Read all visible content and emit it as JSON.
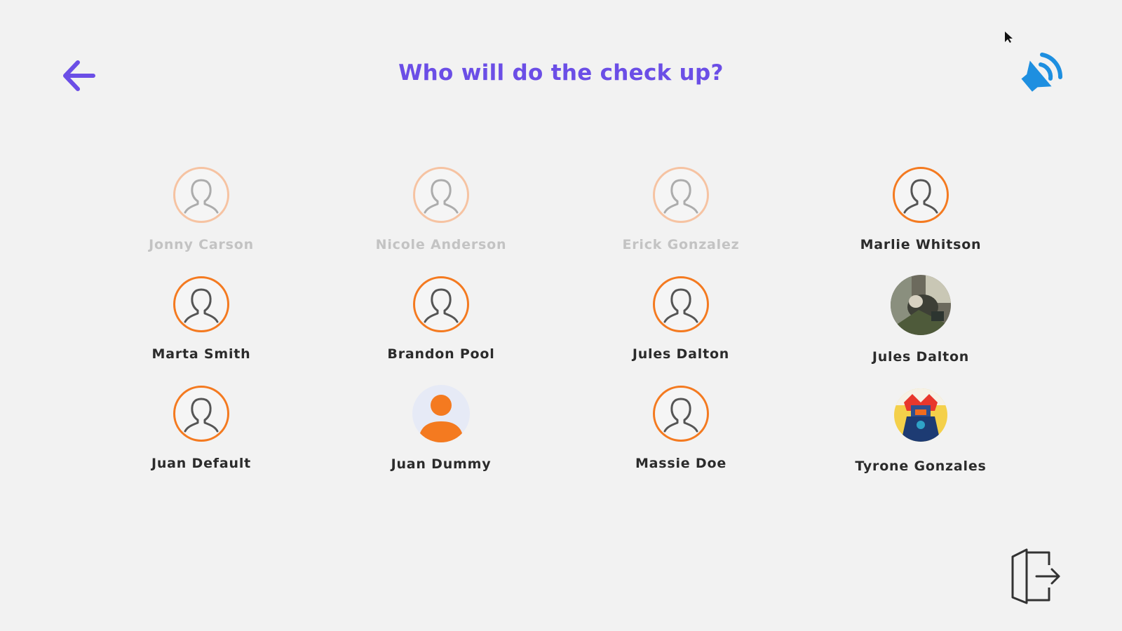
{
  "header": {
    "title": "Who will do the check up?",
    "back_icon": "arrow-left-icon",
    "speaker_icon": "speaker-icon"
  },
  "colors": {
    "accent": "#6b4ee6",
    "ring": "#f47a20",
    "ring_disabled": "#f6c3a2",
    "speaker": "#1e8fe0"
  },
  "users": [
    {
      "name": "Jonny  Carson",
      "avatar": "default",
      "disabled": true
    },
    {
      "name": "Nicole Anderson",
      "avatar": "default",
      "disabled": true
    },
    {
      "name": "Erick Gonzalez",
      "avatar": "default",
      "disabled": true
    },
    {
      "name": "Marlie Whitson",
      "avatar": "default",
      "disabled": false
    },
    {
      "name": "Marta Smith",
      "avatar": "default",
      "disabled": false
    },
    {
      "name": "Brandon Pool",
      "avatar": "default",
      "disabled": false
    },
    {
      "name": "Jules Dalton",
      "avatar": "default",
      "disabled": false
    },
    {
      "name": "Jules Dalton",
      "avatar": "photo",
      "disabled": false
    },
    {
      "name": "Juan Default",
      "avatar": "default",
      "disabled": false
    },
    {
      "name": "Juan Dummy",
      "avatar": "filled",
      "disabled": false
    },
    {
      "name": "Massie Doe",
      "avatar": "default",
      "disabled": false
    },
    {
      "name": "Tyrone Gonzales",
      "avatar": "photo",
      "disabled": false
    }
  ],
  "footer": {
    "exit_icon": "logout-door-icon"
  }
}
